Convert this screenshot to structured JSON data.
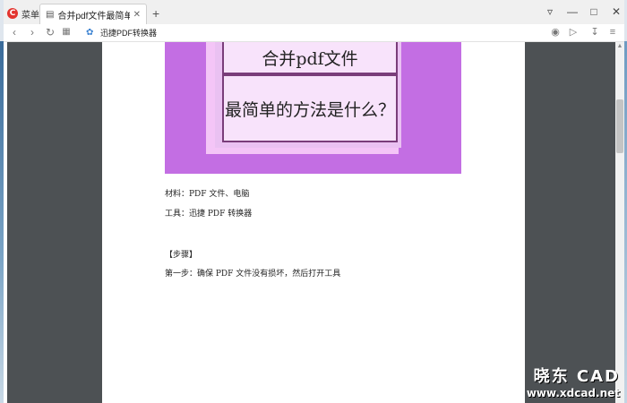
{
  "browser": {
    "menu_label": "菜单",
    "tab_title": "合并pdf文件最简单的方法",
    "new_tab": "+",
    "address": "迅捷PDF转换器"
  },
  "icons": {
    "logo": "browser-logo",
    "back": "back-arrow-icon",
    "forward": "forward-arrow-icon",
    "reload": "reload-icon",
    "apps": "apps-grid-icon",
    "camera": "camera-icon",
    "send": "send-icon",
    "download": "download-icon",
    "settings": "sliders-icon",
    "menu": "tab-list-icon",
    "minimize": "minimize-icon",
    "maximize": "maximize-icon",
    "close": "close-icon"
  },
  "document": {
    "banner": {
      "line1": "合并pdf文件",
      "line2": "最简单的方法是什么？"
    },
    "materials": "材料：PDF 文件、电脑",
    "tool": "工具：迅捷 PDF 转换器",
    "steps_heading": "【步骤】",
    "step1": "第一步：确保 PDF 文件没有损坏，然后打开工具"
  },
  "watermark": {
    "brand": "晓东 CAD",
    "url": "www.xdcad.net"
  },
  "colors": {
    "banner_bg": "#c36ee3",
    "viewer_bg": "#4d5154",
    "logo_red": "#e3342f"
  }
}
